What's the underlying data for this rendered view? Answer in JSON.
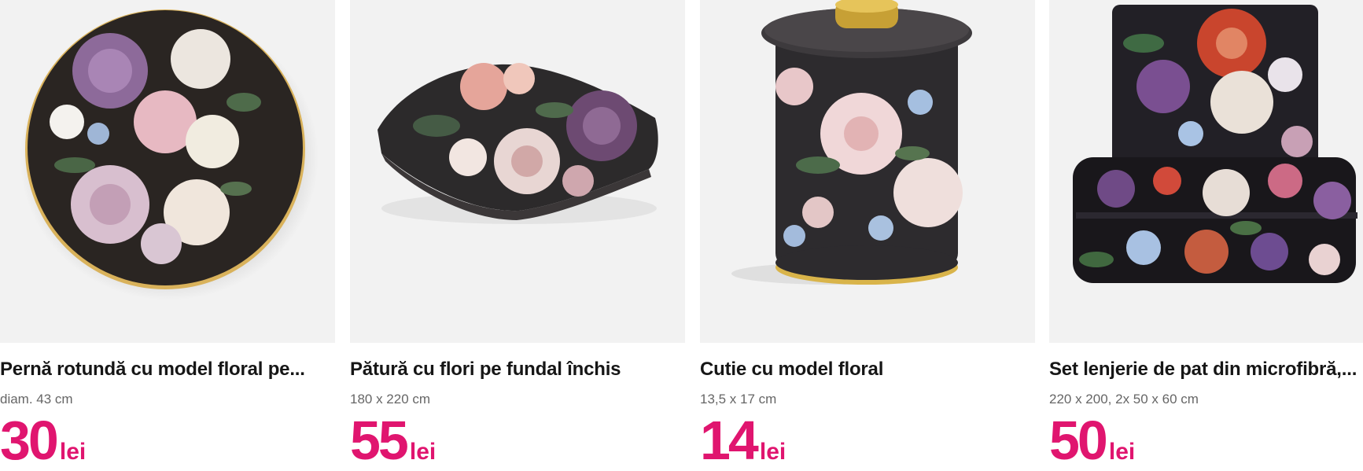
{
  "accent_color": "#e0156f",
  "products": [
    {
      "title": "Pernă rotundă cu model floral pe...",
      "subtitle": "diam. 43 cm",
      "price": "30",
      "currency": "lei",
      "image_icon": "round-floral-pillow-image"
    },
    {
      "title": "Pătură cu flori pe fundal închis",
      "subtitle": "180 x 220 cm",
      "price": "55",
      "currency": "lei",
      "image_icon": "folded-floral-blanket-image"
    },
    {
      "title": "Cutie cu model floral",
      "subtitle": "13,5 x 17 cm",
      "price": "14",
      "currency": "lei",
      "image_icon": "floral-tin-box-image"
    },
    {
      "title": "Set lenjerie de pat din microfibră,...",
      "subtitle": "220 x 200, 2x 50 x 60 cm",
      "price": "50",
      "currency": "lei",
      "image_icon": "floral-bedding-set-image"
    }
  ]
}
